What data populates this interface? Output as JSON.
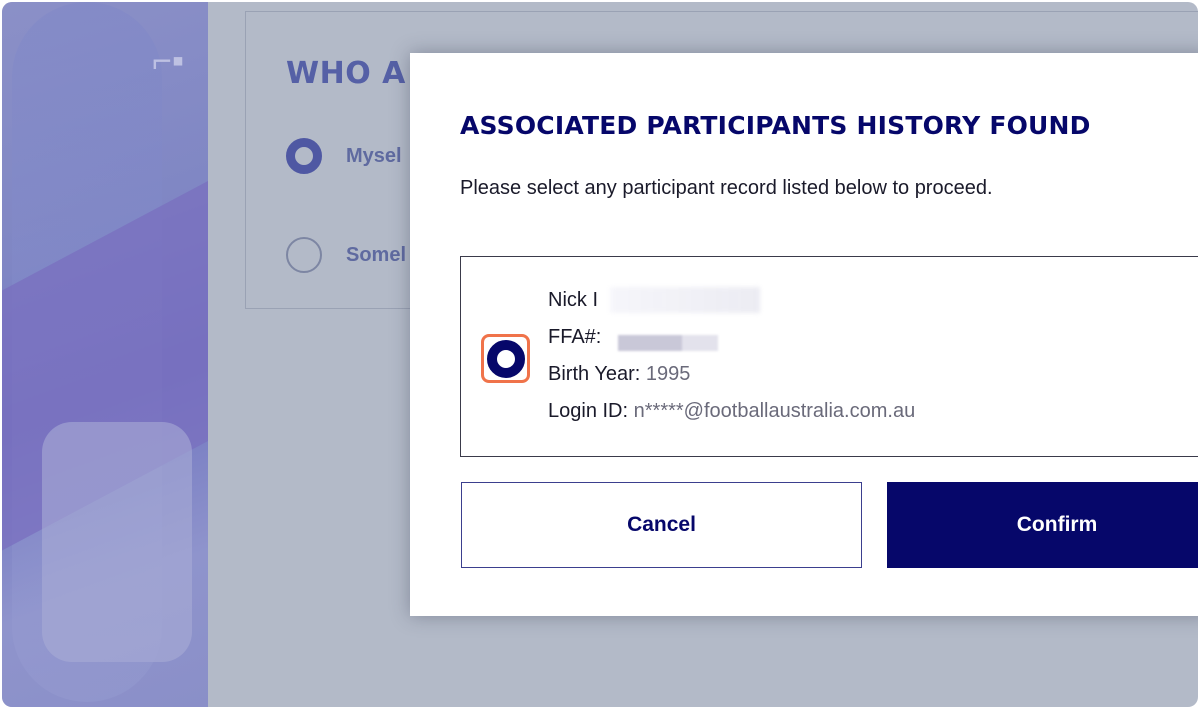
{
  "background_form": {
    "title": "WHO A",
    "options": [
      {
        "label": "Mysel",
        "selected": true
      },
      {
        "label": "Somel",
        "selected": false
      }
    ]
  },
  "modal": {
    "title": "ASSOCIATED PARTICIPANTS HISTORY FOUND",
    "subtitle": "Please select any participant record listed below to proceed.",
    "record": {
      "name": "Nick I",
      "ffa_label": "FFA#:",
      "birth_year_label": "Birth Year:",
      "birth_year_value": "1995",
      "login_label": "Login ID:",
      "login_value": "n*****@footballaustralia.com.au",
      "selected": true
    },
    "cancel_label": "Cancel",
    "confirm_label": "Confirm"
  },
  "colors": {
    "brand_navy": "#06076a",
    "focus_ring": "#f0734a",
    "overlay": "#b3bac8"
  }
}
